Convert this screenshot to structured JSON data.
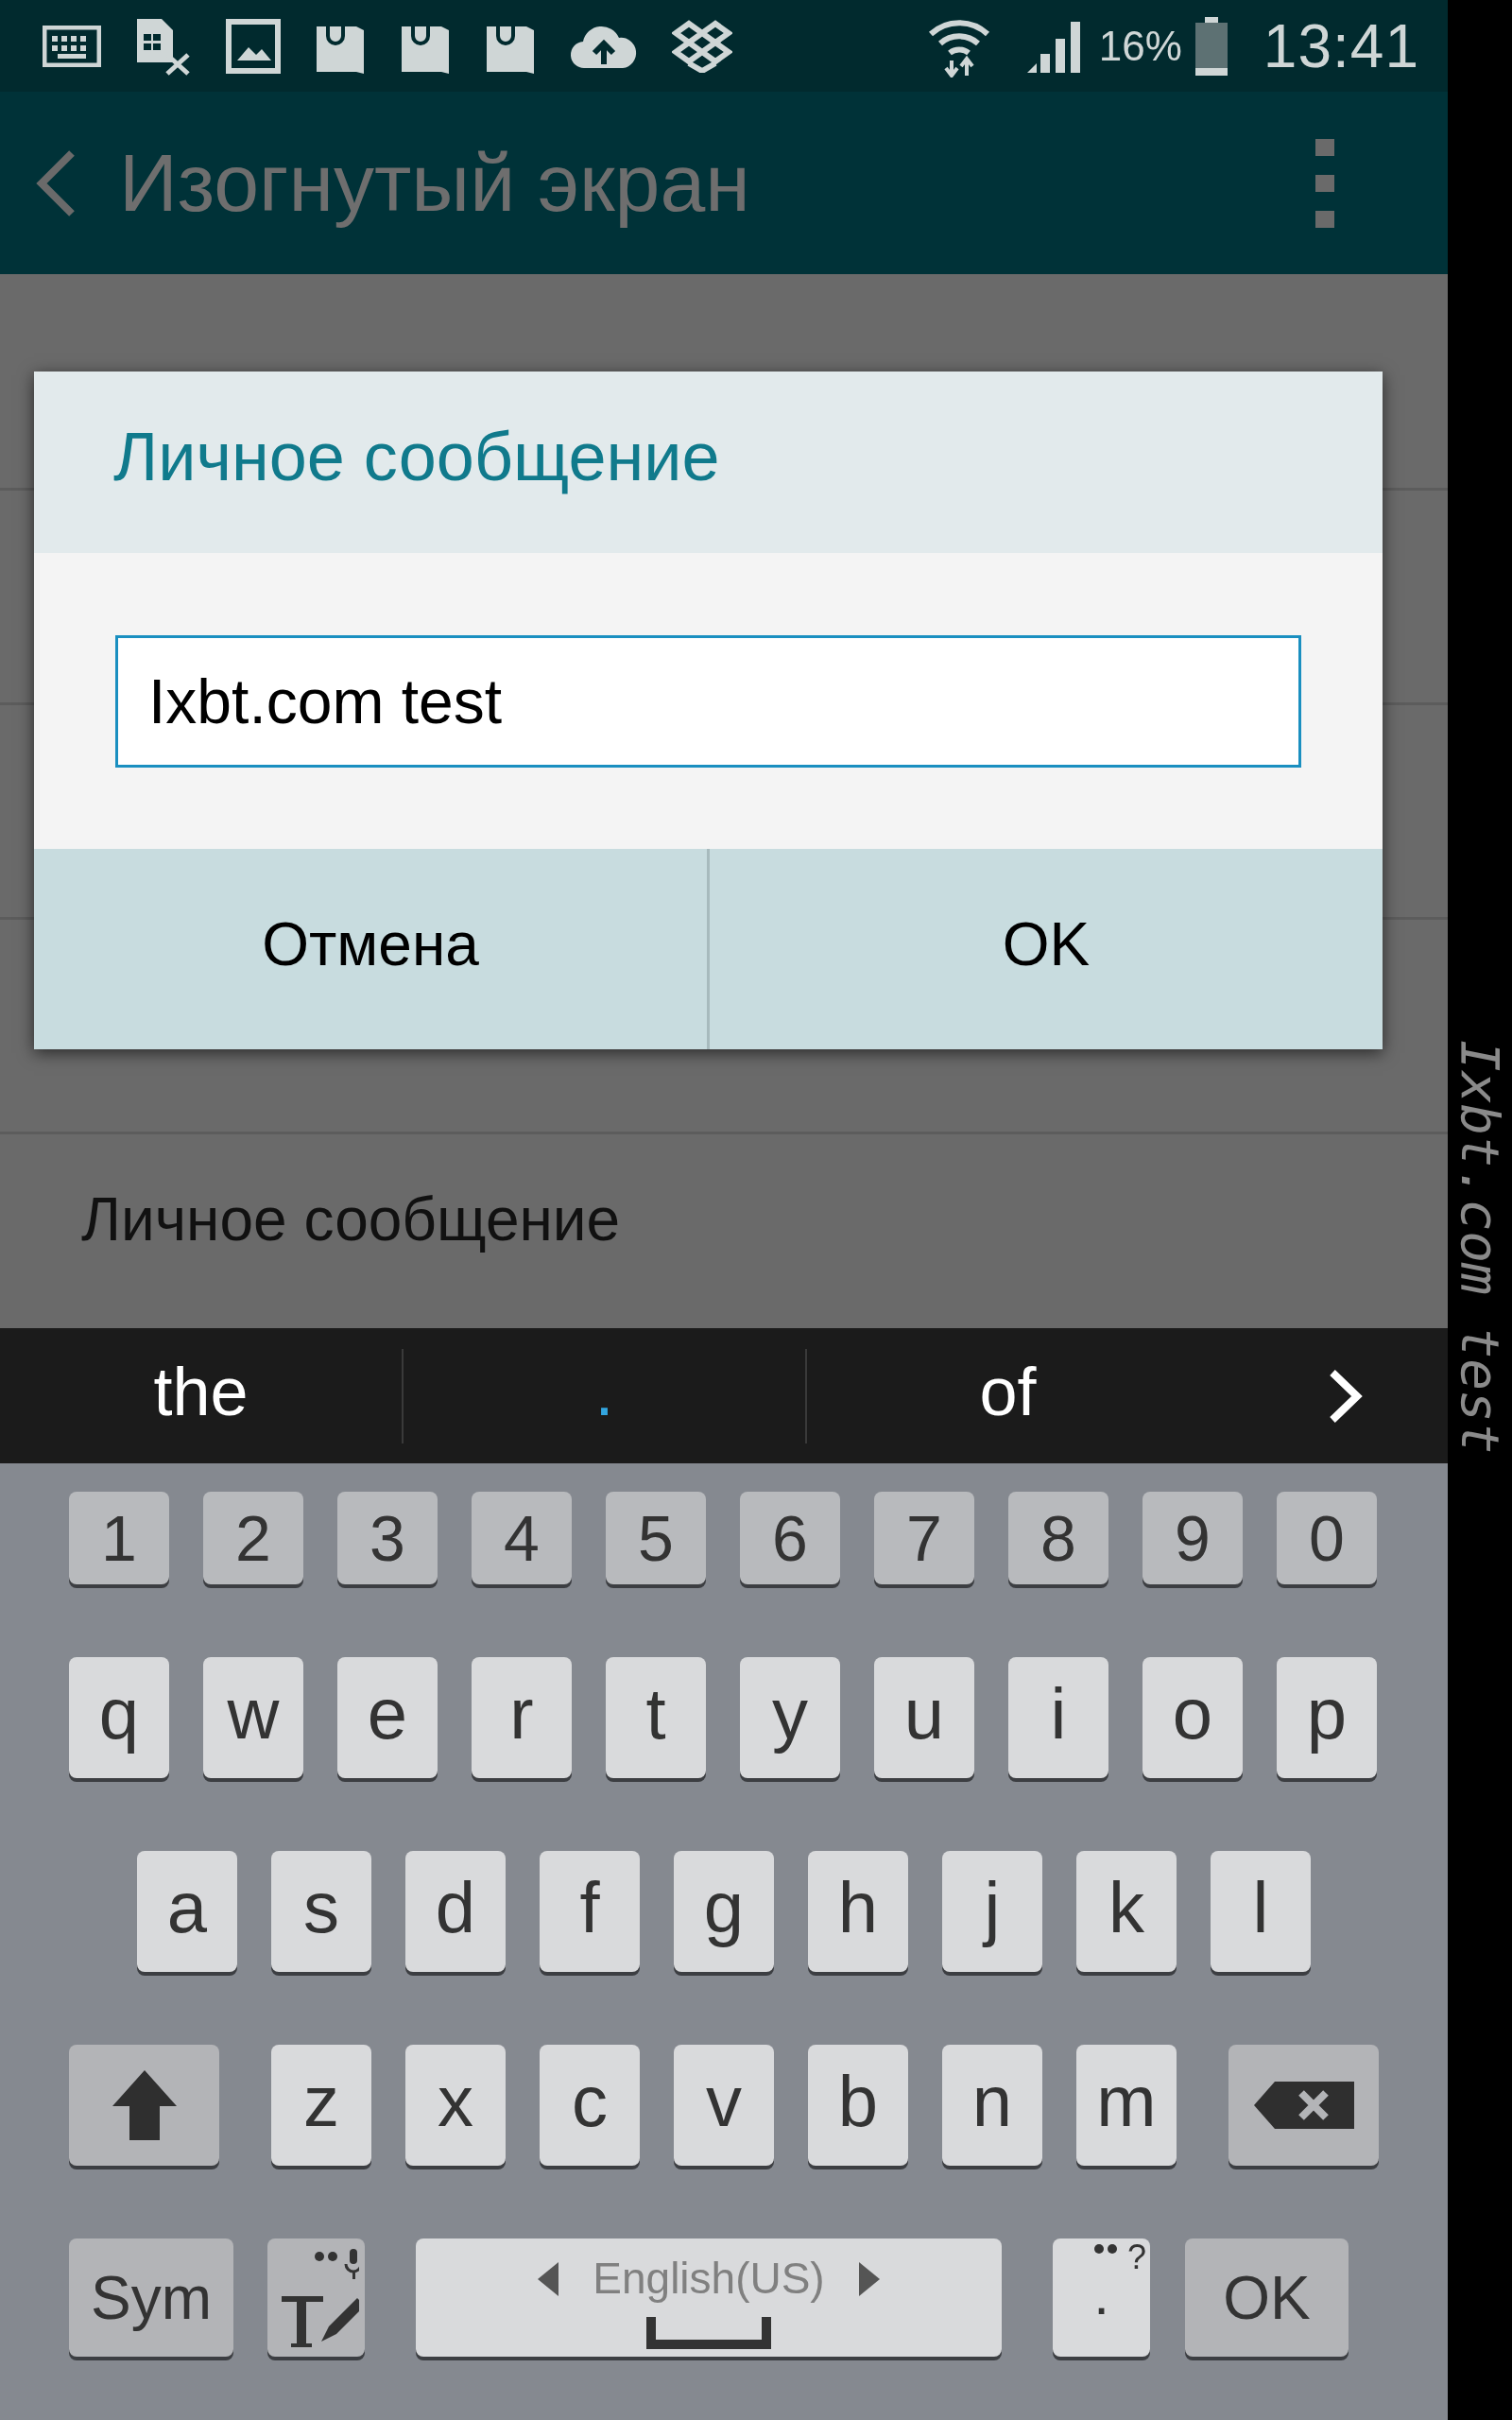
{
  "status_bar": {
    "battery": "16%",
    "time": "13:41"
  },
  "app_bar": {
    "title": "Изогнутый экран"
  },
  "settings_list": [
    {
      "label": "Личное сообщение"
    }
  ],
  "dialog": {
    "title": "Личное сообщение",
    "field": {
      "value": "Ixbt.com test"
    },
    "buttons": [
      "Отмена",
      "OK"
    ]
  },
  "suggestions": [
    {
      "text": "the",
      "highlighted": false
    },
    {
      "text": ".",
      "highlighted": true
    },
    {
      "text": "of",
      "highlighted": false
    }
  ],
  "keyboard": {
    "rows": [
      {
        "keys": [
          {
            "kind": "digit",
            "label": "1"
          },
          {
            "kind": "digit",
            "label": "2"
          },
          {
            "kind": "digit",
            "label": "3"
          },
          {
            "kind": "digit",
            "label": "4"
          },
          {
            "kind": "digit",
            "label": "5"
          },
          {
            "kind": "digit",
            "label": "6"
          },
          {
            "kind": "digit",
            "label": "7"
          },
          {
            "kind": "digit",
            "label": "8"
          },
          {
            "kind": "digit",
            "label": "9"
          },
          {
            "kind": "digit",
            "label": "0"
          }
        ]
      },
      {
        "keys": [
          {
            "kind": "char",
            "label": "q"
          },
          {
            "kind": "char",
            "label": "w"
          },
          {
            "kind": "char",
            "label": "e"
          },
          {
            "kind": "char",
            "label": "r"
          },
          {
            "kind": "char",
            "label": "t"
          },
          {
            "kind": "char",
            "label": "y"
          },
          {
            "kind": "char",
            "label": "u"
          },
          {
            "kind": "char",
            "label": "i"
          },
          {
            "kind": "char",
            "label": "o"
          },
          {
            "kind": "char",
            "label": "p"
          }
        ]
      },
      {
        "keys": [
          {
            "kind": "char",
            "label": "a"
          },
          {
            "kind": "char",
            "label": "s"
          },
          {
            "kind": "char",
            "label": "d"
          },
          {
            "kind": "char",
            "label": "f"
          },
          {
            "kind": "char",
            "label": "g"
          },
          {
            "kind": "char",
            "label": "h"
          },
          {
            "kind": "char",
            "label": "j"
          },
          {
            "kind": "char",
            "label": "k"
          },
          {
            "kind": "char",
            "label": "l"
          }
        ]
      },
      {
        "keys": [
          {
            "kind": "shift"
          },
          {
            "kind": "char",
            "label": "z"
          },
          {
            "kind": "char",
            "label": "x"
          },
          {
            "kind": "char",
            "label": "c"
          },
          {
            "kind": "char",
            "label": "v"
          },
          {
            "kind": "char",
            "label": "b"
          },
          {
            "kind": "char",
            "label": "n"
          },
          {
            "kind": "char",
            "label": "m"
          },
          {
            "kind": "backspace"
          }
        ]
      },
      {
        "keys": [
          {
            "kind": "sym",
            "label": "Sym"
          },
          {
            "kind": "handwriting"
          },
          {
            "kind": "space",
            "label": "English(US)"
          },
          {
            "kind": "period",
            "label": ".",
            "hint": "?"
          },
          {
            "kind": "ok",
            "label": "OK"
          }
        ]
      }
    ]
  },
  "edge_screen": {
    "message": "Ixbt.com test"
  }
}
